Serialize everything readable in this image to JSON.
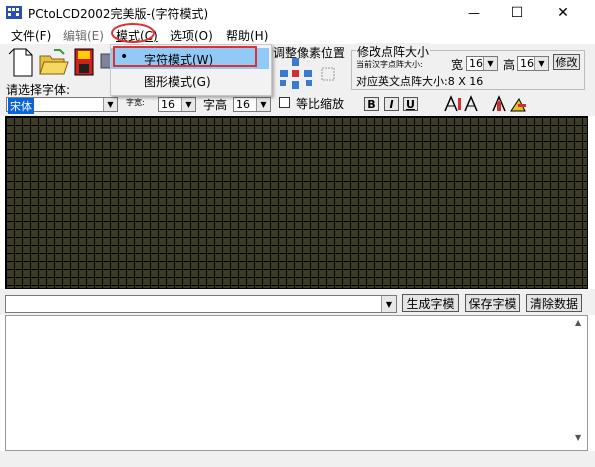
{
  "window": {
    "title": "PCtoLCD2002完美版-(字符模式)",
    "minimize_glyph": "—",
    "maximize_glyph": "☐",
    "close_glyph": "✕"
  },
  "menu": {
    "file": "文件(F)",
    "edit": "编辑(E)",
    "mode": "模式(C)",
    "options": "选项(O)",
    "help": "帮助(H)"
  },
  "mode_menu": {
    "items": [
      {
        "label": "字符模式(W)",
        "checked": true
      },
      {
        "label": "图形模式(G)",
        "checked": false
      }
    ],
    "bullet": "•"
  },
  "toolbar": {
    "choose_font_label": "请选择字体:",
    "font_value": "宋体",
    "char_width_label": "字宽:",
    "char_width_value": "16",
    "char_height_label": "字高",
    "char_height_value": "16",
    "proportional_scale_label": "等比缩放",
    "adjust_pixel_label": "调整像素位置",
    "modify_matrix_label": "修改点阵大小",
    "current_char_matrix_label": "当前汉字点阵大小:",
    "width_label": "宽",
    "width_value": "16",
    "height_label": "高",
    "height_value": "16",
    "modify_button": "修改",
    "english_matrix_label": "对应英文点阵大小:8 X 16",
    "bold": "B",
    "italic": "I",
    "underline": "U"
  },
  "actions": {
    "generate": "生成字模",
    "save": "保存字模",
    "clear": "清除数据"
  },
  "colors": {
    "grid_cell": "#3c3c28",
    "grid_line": "#000000",
    "menu_highlight": "#91c9f7",
    "annotation_red": "#e03030"
  }
}
